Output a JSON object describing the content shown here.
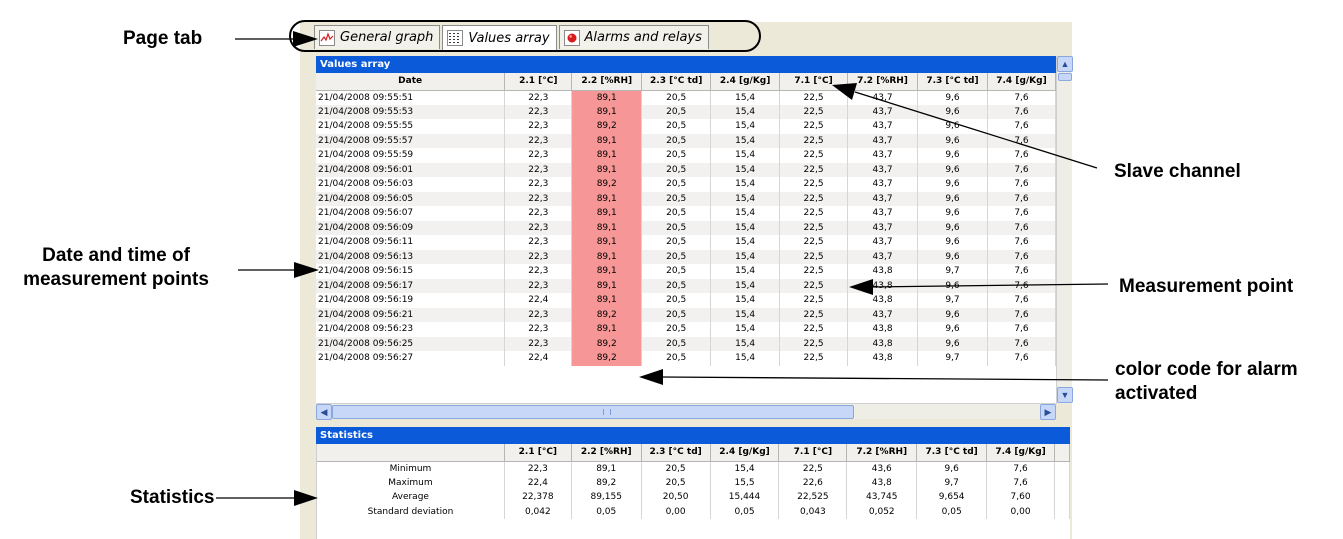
{
  "annotations": {
    "page_tab": "Page tab",
    "slave_channel": "Slave channel",
    "date_time_line1": "Date and time of",
    "date_time_line2": "measurement points",
    "measurement_point": "Measurement point",
    "color_code_line1": "color code for alarm",
    "color_code_line2": "activated",
    "statistics": "Statistics"
  },
  "tabs": [
    {
      "label": "General graph",
      "icon": "line-graph-icon",
      "active": false
    },
    {
      "label": "Values array",
      "icon": "table-grid-icon",
      "active": true
    },
    {
      "label": "Alarms and relays",
      "icon": "red-alarm-dot-icon",
      "active": false
    }
  ],
  "values_panel": {
    "title": "Values array",
    "columns": [
      "Date",
      "2.1 [°C]",
      "2.2 [%RH]",
      "2.3 [°C td]",
      "2.4 [g/Kg]",
      "7.1 [°C]",
      "7.2 [%RH]",
      "7.3 [°C td]",
      "7.4 [g/Kg]"
    ],
    "rows": [
      [
        "21/04/2008 09:55:51",
        "22,3",
        "89,1",
        "20,5",
        "15,4",
        "22,5",
        "43,7",
        "9,6",
        "7,6"
      ],
      [
        "21/04/2008 09:55:53",
        "22,3",
        "89,1",
        "20,5",
        "15,4",
        "22,5",
        "43,7",
        "9,6",
        "7,6"
      ],
      [
        "21/04/2008 09:55:55",
        "22,3",
        "89,2",
        "20,5",
        "15,4",
        "22,5",
        "43,7",
        "9,6",
        "7,6"
      ],
      [
        "21/04/2008 09:55:57",
        "22,3",
        "89,1",
        "20,5",
        "15,4",
        "22,5",
        "43,7",
        "9,6",
        "7,6"
      ],
      [
        "21/04/2008 09:55:59",
        "22,3",
        "89,1",
        "20,5",
        "15,4",
        "22,5",
        "43,7",
        "9,6",
        "7,6"
      ],
      [
        "21/04/2008 09:56:01",
        "22,3",
        "89,1",
        "20,5",
        "15,4",
        "22,5",
        "43,7",
        "9,6",
        "7,6"
      ],
      [
        "21/04/2008 09:56:03",
        "22,3",
        "89,2",
        "20,5",
        "15,4",
        "22,5",
        "43,7",
        "9,6",
        "7,6"
      ],
      [
        "21/04/2008 09:56:05",
        "22,3",
        "89,1",
        "20,5",
        "15,4",
        "22,5",
        "43,7",
        "9,6",
        "7,6"
      ],
      [
        "21/04/2008 09:56:07",
        "22,3",
        "89,1",
        "20,5",
        "15,4",
        "22,5",
        "43,7",
        "9,6",
        "7,6"
      ],
      [
        "21/04/2008 09:56:09",
        "22,3",
        "89,1",
        "20,5",
        "15,4",
        "22,5",
        "43,7",
        "9,6",
        "7,6"
      ],
      [
        "21/04/2008 09:56:11",
        "22,3",
        "89,1",
        "20,5",
        "15,4",
        "22,5",
        "43,7",
        "9,6",
        "7,6"
      ],
      [
        "21/04/2008 09:56:13",
        "22,3",
        "89,1",
        "20,5",
        "15,4",
        "22,5",
        "43,7",
        "9,6",
        "7,6"
      ],
      [
        "21/04/2008 09:56:15",
        "22,3",
        "89,1",
        "20,5",
        "15,4",
        "22,5",
        "43,8",
        "9,7",
        "7,6"
      ],
      [
        "21/04/2008 09:56:17",
        "22,3",
        "89,1",
        "20,5",
        "15,4",
        "22,5",
        "43,8",
        "9,6",
        "7,6"
      ],
      [
        "21/04/2008 09:56:19",
        "22,4",
        "89,1",
        "20,5",
        "15,4",
        "22,5",
        "43,8",
        "9,7",
        "7,6"
      ],
      [
        "21/04/2008 09:56:21",
        "22,3",
        "89,2",
        "20,5",
        "15,4",
        "22,5",
        "43,7",
        "9,6",
        "7,6"
      ],
      [
        "21/04/2008 09:56:23",
        "22,3",
        "89,1",
        "20,5",
        "15,4",
        "22,5",
        "43,8",
        "9,6",
        "7,6"
      ],
      [
        "21/04/2008 09:56:25",
        "22,3",
        "89,2",
        "20,5",
        "15,4",
        "22,5",
        "43,8",
        "9,6",
        "7,6"
      ],
      [
        "21/04/2008 09:56:27",
        "22,4",
        "89,2",
        "20,5",
        "15,4",
        "22,5",
        "43,8",
        "9,7",
        "7,6"
      ]
    ],
    "alarm_column_index": 2,
    "alarm_color": "#f69696"
  },
  "stats_panel": {
    "title": "Statistics",
    "columns": [
      "",
      "2.1 [°C]",
      "2.2 [%RH]",
      "2.3 [°C td]",
      "2.4 [g/Kg]",
      "7.1 [°C]",
      "7.2 [%RH]",
      "7.3 [°C td]",
      "7.4 [g/Kg]"
    ],
    "rows": [
      [
        "Minimum",
        "22,3",
        "89,1",
        "20,5",
        "15,4",
        "22,5",
        "43,6",
        "9,6",
        "7,6"
      ],
      [
        "Maximum",
        "22,4",
        "89,2",
        "20,5",
        "15,5",
        "22,6",
        "43,8",
        "9,7",
        "7,6"
      ],
      [
        "Average",
        "22,378",
        "89,155",
        "20,50",
        "15,444",
        "22,525",
        "43,745",
        "9,654",
        "7,60"
      ],
      [
        "Standard deviation",
        "0,042",
        "0,05",
        "0,00",
        "0,05",
        "0,043",
        "0,052",
        "0,05",
        "0,00"
      ]
    ]
  },
  "colors": {
    "panel_header": "#0a5ad9",
    "window_bg": "#ece9d8",
    "scrollbar": "#c7d7f7"
  }
}
